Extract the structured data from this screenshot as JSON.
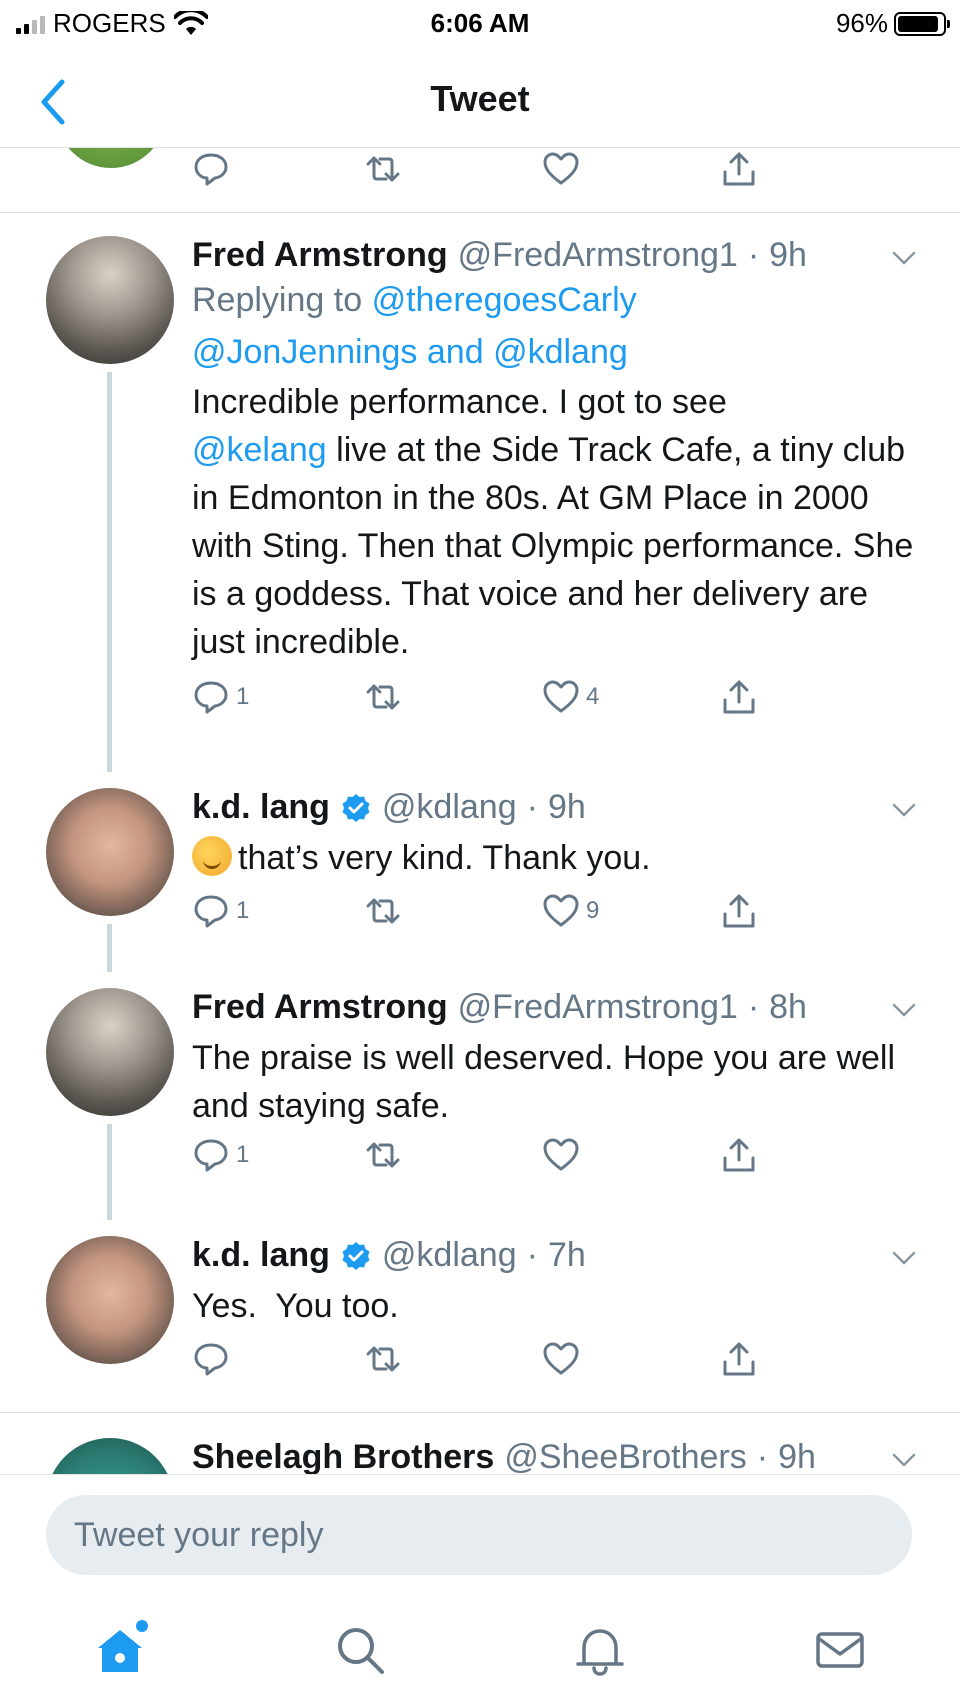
{
  "status_bar": {
    "carrier": "ROGERS",
    "time": "6:06 AM",
    "battery": "96%"
  },
  "header": {
    "title": "Tweet"
  },
  "tweets": [
    {
      "name": "Fred Armstrong",
      "handle": "@FredArmstrong1",
      "dot": "·",
      "time": "9h",
      "replying_to_prefix": "Replying to",
      "replying_to_1": "@theregoesCarly",
      "replying_to_2": "@JonJennings",
      "replying_to_and": "and",
      "replying_to_3": "@kdlang",
      "body_1": "Incredible performance. I got to see",
      "body_mention": "@kelang",
      "body_2": "live at the Side Track Cafe, a tiny club in Edmonton in the 80s. At GM Place in 2000 with Sting. Then that Olympic performance. She is a goddess. That voice and her delivery are just incredible.",
      "replies": "1",
      "likes": "4"
    },
    {
      "name": "k.d. lang",
      "handle": "@kdlang",
      "dot": "·",
      "time": "9h",
      "body": "that’s very kind. Thank you.",
      "replies": "1",
      "likes": "9"
    },
    {
      "name": "Fred Armstrong",
      "handle": "@FredArmstrong1",
      "dot": "·",
      "time": "8h",
      "body": "The praise is well deserved. Hope you are well and staying safe.",
      "replies": "1",
      "likes": ""
    },
    {
      "name": "k.d. lang",
      "handle": "@kdlang",
      "dot": "·",
      "time": "7h",
      "body": "Yes.  You too.",
      "replies": "",
      "likes": ""
    },
    {
      "name": "Sheelagh Brothers",
      "handle": "@SheeBrothers",
      "dot": "·",
      "time": "9h"
    }
  ],
  "reply_bar": {
    "placeholder": "Tweet your reply"
  },
  "tab_bar": {
    "icons": [
      "home-icon",
      "search-icon",
      "bell-icon",
      "mail-icon"
    ]
  },
  "colors": {
    "accent": "#1d9bf0",
    "muted": "#657786",
    "text": "#14171a",
    "divider": "#dfe3e6"
  }
}
